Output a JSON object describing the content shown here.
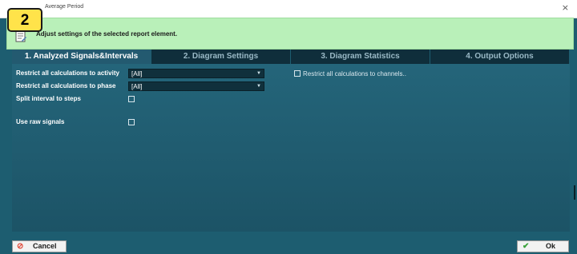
{
  "window": {
    "title": "Average Period",
    "close_glyph": "×"
  },
  "step_badge": "2",
  "banner": {
    "message": "Adjust settings of the selected report element.",
    "icon": "document-edit-icon"
  },
  "tabs": [
    {
      "label": "1. Analyzed Signals&Intervals",
      "active": true
    },
    {
      "label": "2. Diagram Settings",
      "active": false
    },
    {
      "label": "3. Diagram Statistics",
      "active": false
    },
    {
      "label": "4. Output Options",
      "active": false
    }
  ],
  "form": {
    "activity_label": "Restrict all calculations to activity",
    "activity_value": "[All]",
    "phase_label": "Restrict all calculations to phase",
    "phase_value": "[All]",
    "split_label": "Split interval to steps",
    "split_checked": false,
    "raw_label": "Use raw signals",
    "raw_checked": false,
    "channels_label": "Restrict all calculations to channels..",
    "channels_checked": false
  },
  "footer": {
    "cancel_label": "Cancel",
    "cancel_icon": "cancel-circle-icon",
    "ok_label": "Ok",
    "ok_icon": "checkmark-icon"
  },
  "colors": {
    "panel": "#1d5d70",
    "banner": "#b9f0b9",
    "active_tab": "#235a70",
    "inactive_tab": "#0f2e3b",
    "badge": "#ffe34a"
  }
}
